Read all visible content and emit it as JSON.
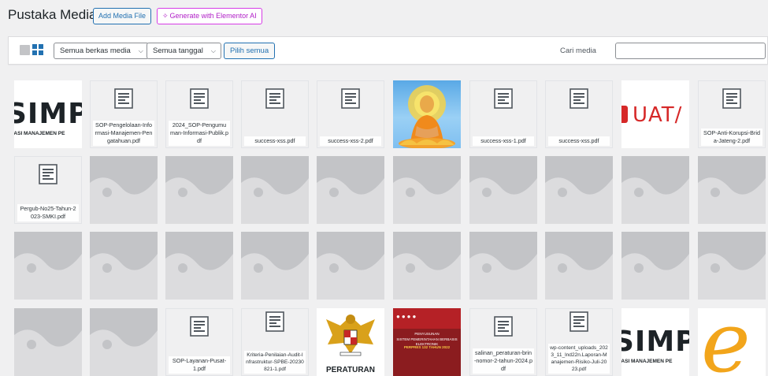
{
  "header": {
    "title": "Pustaka Media",
    "add_button": "Add Media File",
    "ai_button": "Generate with Elementor AI"
  },
  "toolbar": {
    "filter_type": "Semua berkas media",
    "filter_date": "Semua tanggal",
    "select_all": "Pilih semua",
    "search_label": "Cari media",
    "search_value": ""
  },
  "colors": {
    "accent": "#2271b1",
    "ai_accent": "#b01ec7",
    "placeholder_bg": "#dcdcde"
  },
  "icons": {
    "view_list": "list-view-icon",
    "view_grid": "grid-view-icon",
    "document": "document-icon",
    "placeholder": "image-placeholder-icon"
  },
  "rows": [
    [
      {
        "kind": "image-simp",
        "text_big": "SIMP",
        "text_small": "MASI MANAJEMEN PE"
      },
      {
        "kind": "file",
        "name": "SOP-Pengelolaan-Informasi-Manajemen-Pengatahuan.pdf"
      },
      {
        "kind": "file",
        "name": "2024_SOP-Pengumuman-Informasi-Publik.pdf"
      },
      {
        "kind": "file",
        "name": "success-xss.pdf"
      },
      {
        "kind": "file",
        "name": "success-xss-2.pdf"
      },
      {
        "kind": "image-buddha"
      },
      {
        "kind": "file",
        "name": "success-xss-1.pdf"
      },
      {
        "kind": "file",
        "name": "success-xss.pdf"
      },
      {
        "kind": "image-uat",
        "text": "UAT/"
      },
      {
        "kind": "file",
        "name": "SOP-Anti-Korupsi-Brida-Jateng-2.pdf"
      }
    ],
    [
      {
        "kind": "file",
        "name": "Pergub-No25-Tahun-2023-SMKI.pdf"
      },
      {
        "kind": "placeholder"
      },
      {
        "kind": "placeholder"
      },
      {
        "kind": "placeholder"
      },
      {
        "kind": "placeholder"
      },
      {
        "kind": "placeholder"
      },
      {
        "kind": "placeholder"
      },
      {
        "kind": "placeholder"
      },
      {
        "kind": "placeholder"
      },
      {
        "kind": "placeholder"
      }
    ],
    [
      {
        "kind": "placeholder"
      },
      {
        "kind": "placeholder"
      },
      {
        "kind": "placeholder"
      },
      {
        "kind": "placeholder"
      },
      {
        "kind": "placeholder"
      },
      {
        "kind": "placeholder"
      },
      {
        "kind": "placeholder"
      },
      {
        "kind": "placeholder"
      },
      {
        "kind": "placeholder"
      },
      {
        "kind": "placeholder"
      }
    ],
    [
      {
        "kind": "placeholder"
      },
      {
        "kind": "placeholder"
      },
      {
        "kind": "file",
        "name": "SOP-Layanan-Pusat-1.pdf"
      },
      {
        "kind": "file",
        "name": "Kriteria-Penilaian-Audit-Infrastruktur-SPBE-20230821-1.pdf"
      },
      {
        "kind": "image-garuda",
        "text": "PERATURAN"
      },
      {
        "kind": "image-red",
        "title1": "PENYUSUNAN",
        "title2": "SISTEM PEMERINTAHAN BERBASIS ELEKTRONIK",
        "title3": "PERPRES 132 TAHUN 2022"
      },
      {
        "kind": "file",
        "name": "salinan_peraturan-brin-nomor-2-tahun-2024.pdf"
      },
      {
        "kind": "file",
        "name": "wp-content_uploads_2023_11_lnd22n.Laporan-Manajemen-Risiko-Juli-2023.pdf"
      },
      {
        "kind": "image-simp",
        "text_big": "SIMP",
        "text_small": "MASI MANAJEMEN PE"
      },
      {
        "kind": "image-e",
        "text": "e"
      }
    ]
  ]
}
